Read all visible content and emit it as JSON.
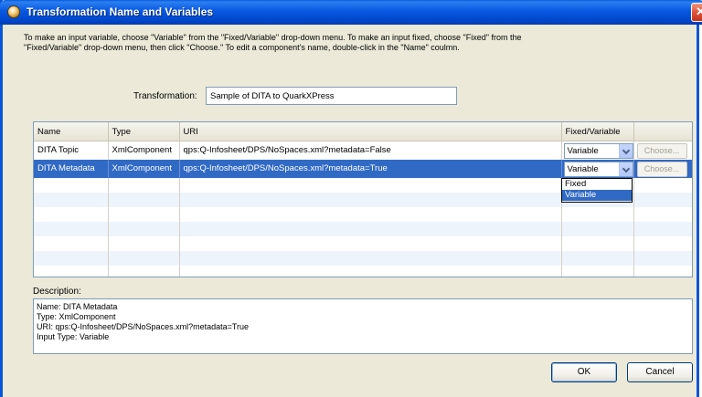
{
  "window": {
    "title": "Transformation Name and Variables",
    "close_glyph": "✕"
  },
  "instructions": {
    "line1": "To make an input variable, choose \"Variable\" from the \"Fixed/Variable\" drop-down menu. To make an input fixed, choose \"Fixed\" from the",
    "line2": "\"Fixed/Variable\" drop-down menu, then click \"Choose.\" To edit a component's name, double-click in the \"Name\" coulmn."
  },
  "transformation": {
    "label": "Transformation:",
    "value": "Sample of DITA to QuarkXPress"
  },
  "grid": {
    "columns": [
      "Name",
      "Type",
      "URI",
      "Fixed/Variable",
      ""
    ],
    "rows": [
      {
        "name": "DITA Topic",
        "type": "XmlComponent",
        "uri": "qps:Q-Infosheet/DPS/NoSpaces.xml?metadata=False",
        "fixed_variable": "Variable",
        "choose_label": "Choose..."
      },
      {
        "name": "DITA Metadata",
        "type": "XmlComponent",
        "uri": "qps:Q-Infosheet/DPS/NoSpaces.xml?metadata=True",
        "fixed_variable": "Variable",
        "choose_label": "Choose..."
      }
    ],
    "selected_row": 1,
    "dropdown_options": [
      "Fixed",
      "Variable"
    ],
    "dropdown_highlighted": "Variable"
  },
  "description": {
    "label": "Description:",
    "lines": [
      "Name: DITA Metadata",
      "Type: XmlComponent",
      "URI: qps:Q-Infosheet/DPS/NoSpaces.xml?metadata=True",
      "Input Type: Variable"
    ]
  },
  "buttons": {
    "ok": "OK",
    "cancel": "Cancel"
  },
  "colors": {
    "titlebar": "#0758e0",
    "selection": "#316ac5",
    "dialog_bg": "#ece9d8"
  },
  "icons": {
    "app": "transformation-app-icon",
    "close": "close-icon",
    "dropdown_arrow": "chevron-down-icon"
  }
}
